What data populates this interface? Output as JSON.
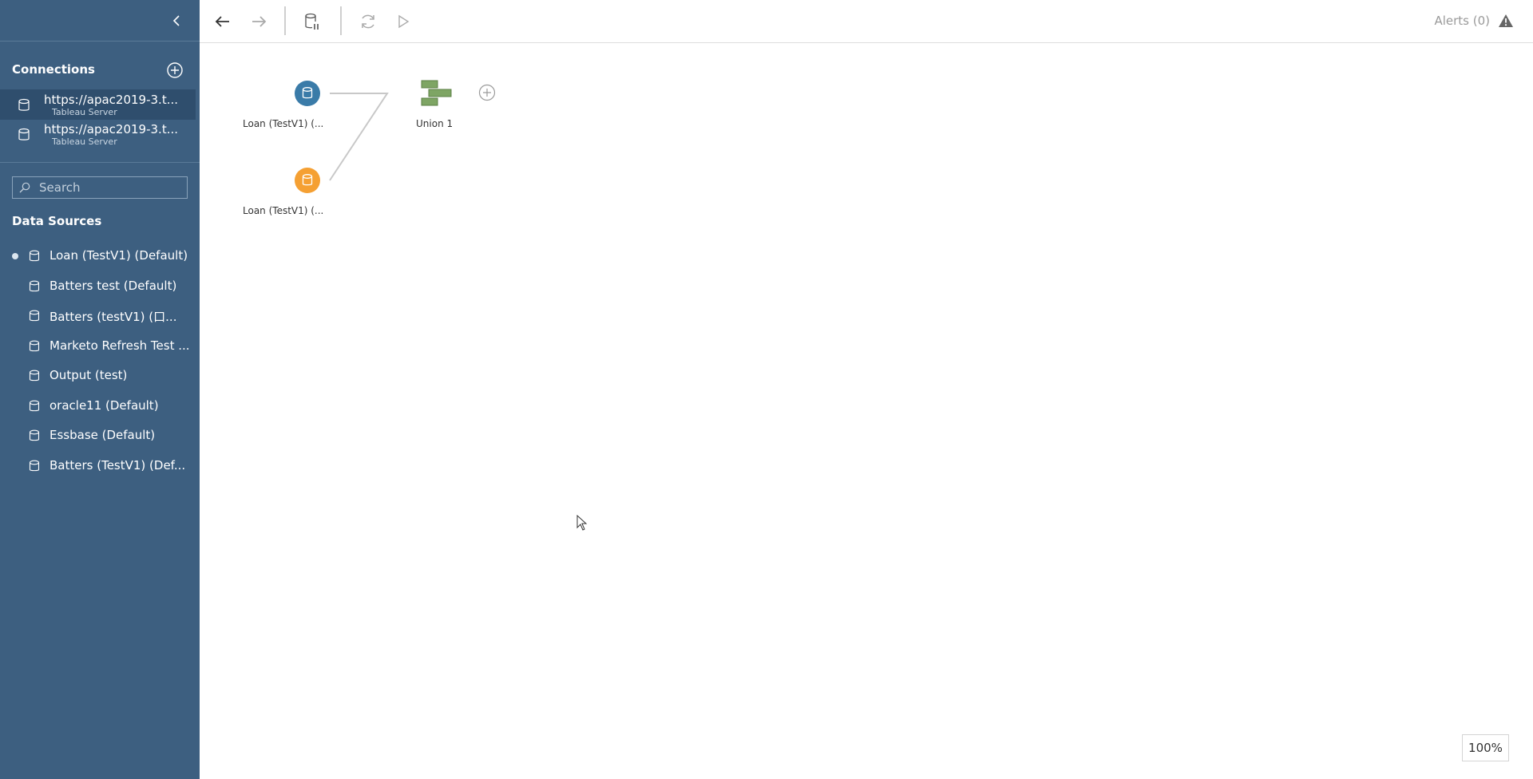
{
  "sidebar": {
    "connections_title": "Connections",
    "connections": [
      {
        "title": "https://apac2019-3.t...",
        "subtitle": "Tableau Server"
      },
      {
        "title": "https://apac2019-3.t...",
        "subtitle": "Tableau Server"
      }
    ],
    "search_placeholder": "Search",
    "data_sources_title": "Data Sources",
    "data_sources": [
      {
        "label": "Loan (TestV1) (Default)"
      },
      {
        "label": "Batters test (Default)"
      },
      {
        "label": "Batters (testV1) (口..."
      },
      {
        "label": "Marketo Refresh Test ..."
      },
      {
        "label": "Output (test)"
      },
      {
        "label": "oracle11 (Default)"
      },
      {
        "label": "Essbase (Default)"
      },
      {
        "label": "Batters (TestV1) (Def..."
      }
    ]
  },
  "toolbar": {
    "alerts_label": "Alerts (0)"
  },
  "canvas": {
    "nodes": [
      {
        "label": "Loan (TestV1) (...",
        "color": "#3a7ba8"
      },
      {
        "label": "Loan (TestV1) (...",
        "color": "#f5a033"
      },
      {
        "label": "Union 1",
        "color": "#6e9a55"
      }
    ],
    "zoom_level": "100%"
  },
  "colors": {
    "sidebar_bg": "#3d5f80",
    "sidebar_selected": "#2f4e6d"
  }
}
